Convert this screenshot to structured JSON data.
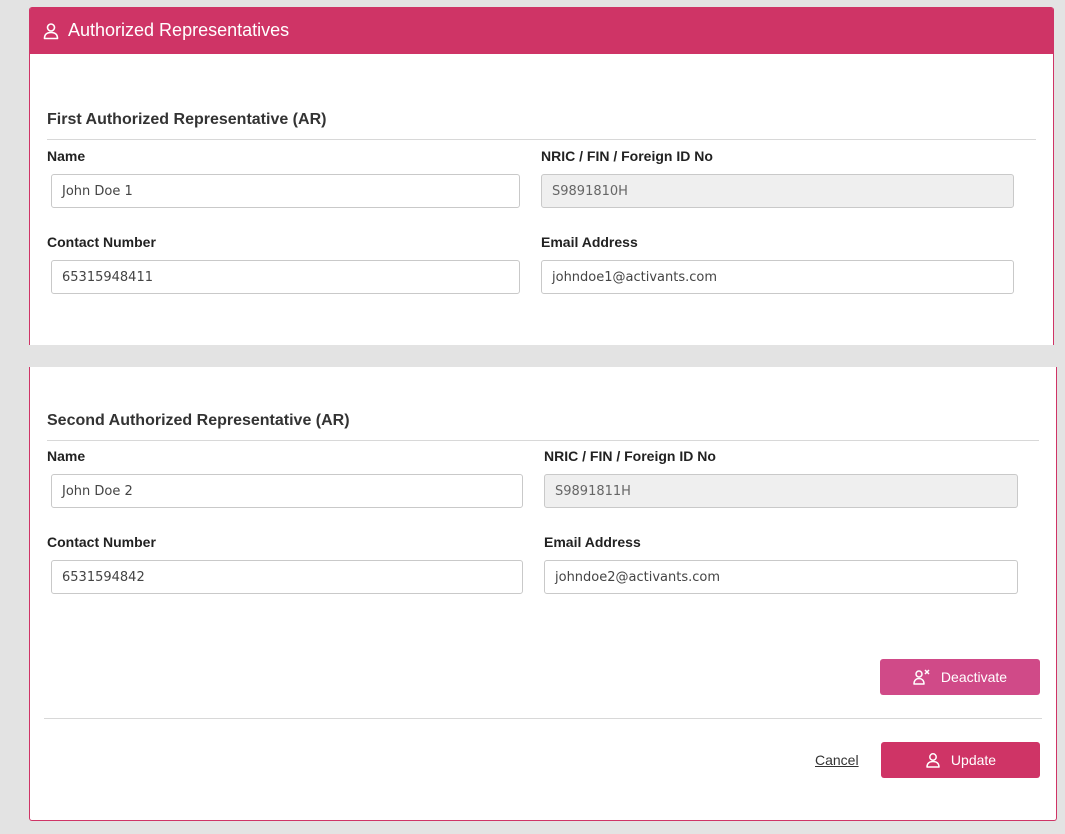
{
  "header": {
    "icon": "user-icon",
    "title": "Authorized Representatives",
    "color": "#cf3466"
  },
  "first_ar": {
    "title": "First Authorized Representative (AR)",
    "name_label": "Name",
    "name_value": "John Doe 1",
    "id_label": "NRIC / FIN / Foreign ID No",
    "id_value": "S9891810H",
    "contact_label": "Contact Number",
    "contact_value": "65315948411",
    "email_label": "Email Address",
    "email_value": "johndoe1@activants.com"
  },
  "second_ar": {
    "title": "Second Authorized Representative (AR)",
    "name_label": "Name",
    "name_value": "John Doe 2",
    "id_label": "NRIC / FIN / Foreign ID No",
    "id_value": "S9891811H",
    "contact_label": "Contact Number",
    "contact_value": "6531594842",
    "email_label": "Email Address",
    "email_value": "johndoe2@activants.com"
  },
  "actions": {
    "deactivate_label": "Deactivate",
    "deactivate_icon": "user-remove-icon",
    "deactivate_color": "#d04a88",
    "cancel_label": "Cancel",
    "update_label": "Update",
    "update_icon": "user-icon",
    "update_color": "#cf3466"
  }
}
